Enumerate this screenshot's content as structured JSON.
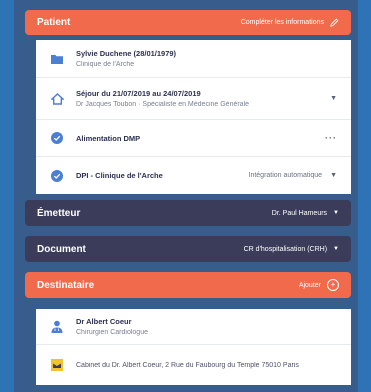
{
  "patient_bar": {
    "title": "Patient",
    "action": "Compléter les informations",
    "icon": "pencil-icon"
  },
  "patient_rows": [
    {
      "icon": "folder-icon",
      "line1": "Sylvie Duchene (28/01/1979)",
      "line2": "Clinique de l'Arche"
    },
    {
      "icon": "home-icon",
      "line1": "Séjour du 21/07/2019 au 24/07/2019",
      "line2": "Dr Jacques Toubon · Spécialiste en Médecine Générale"
    },
    {
      "icon": "check-circle-icon",
      "line1": "Alimentation DMP",
      "line2": ""
    },
    {
      "icon": "check-circle-icon",
      "line1": "DPI - Clinique de l'Arche",
      "meta": "Intégration automatique"
    }
  ],
  "emetteur_bar": {
    "title": "Émetteur",
    "value": "Dr. Paul Hameurs"
  },
  "document_bar": {
    "title": "Document",
    "value": "CR d'hospitalisation (CRH)"
  },
  "destinataire_bar": {
    "title": "Destinataire",
    "action": "Ajouter",
    "icon": "plus-circle-icon"
  },
  "dest_rows": [
    {
      "icon": "doctor-icon",
      "line1": "Dr Albert Coeur",
      "line2": "Chirurgien Cardiologue"
    },
    {
      "icon": "mail-icon",
      "line1": "Cabinet du Dr. Albert Coeur, 2 Rue du Faubourg du Temple 75010 Paris",
      "line2": ""
    }
  ],
  "colors": {
    "orange": "#f26a4c",
    "dark": "#3a3c5a",
    "backdrop": "#2e73b5",
    "panel": "#365d8c",
    "blue_icon": "#4a7fd4"
  }
}
